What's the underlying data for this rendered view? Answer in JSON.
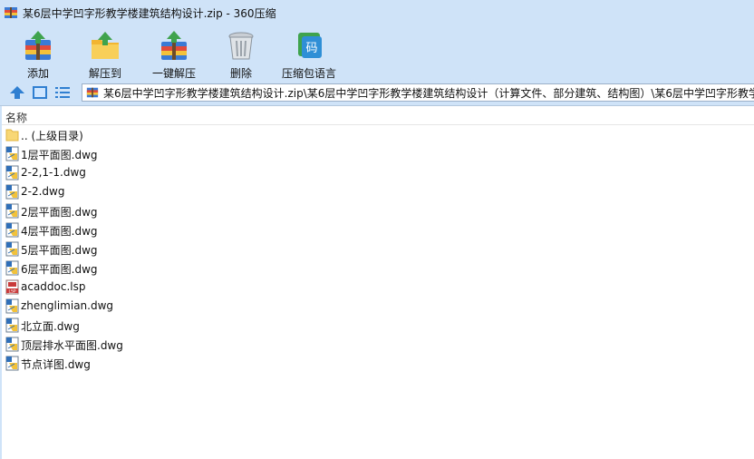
{
  "window": {
    "title": "某6层中学凹字形教学楼建筑结构设计.zip - 360压缩"
  },
  "toolbar": {
    "add_label": "添加",
    "extract_to_label": "解压到",
    "one_click_extract_label": "一键解压",
    "delete_label": "删除",
    "encoding_label": "压缩包语言"
  },
  "navigation": {
    "address_path": "某6层中学凹字形教学楼建筑结构设计.zip\\某6层中学凹字形教学楼建筑结构设计（计算文件、部分建筑、结构图）\\某6层中学凹字形教学"
  },
  "file_list": {
    "column_name": "名称",
    "parent_label": ".. (上级目录)",
    "files": [
      {
        "name": "1层平面图.dwg",
        "icon": "dwg-file-icon"
      },
      {
        "name": "2-2,1-1.dwg",
        "icon": "dwg-file-icon"
      },
      {
        "name": "2-2.dwg",
        "icon": "dwg-file-icon"
      },
      {
        "name": "2层平面图.dwg",
        "icon": "dwg-file-icon"
      },
      {
        "name": "4层平面图.dwg",
        "icon": "dwg-file-icon"
      },
      {
        "name": "5层平面图.dwg",
        "icon": "dwg-file-icon"
      },
      {
        "name": "6层平面图.dwg",
        "icon": "dwg-file-icon"
      },
      {
        "name": "acaddoc.lsp",
        "icon": "lsp-file-icon"
      },
      {
        "name": "zhenglimian.dwg",
        "icon": "dwg-file-icon"
      },
      {
        "name": "北立面.dwg",
        "icon": "dwg-file-icon"
      },
      {
        "name": "顶层排水平面图.dwg",
        "icon": "dwg-file-icon"
      },
      {
        "name": "节点详图.dwg",
        "icon": "dwg-file-icon"
      }
    ]
  },
  "colors": {
    "chrome_background": "#cfe3f8",
    "list_background": "#ffffff"
  }
}
